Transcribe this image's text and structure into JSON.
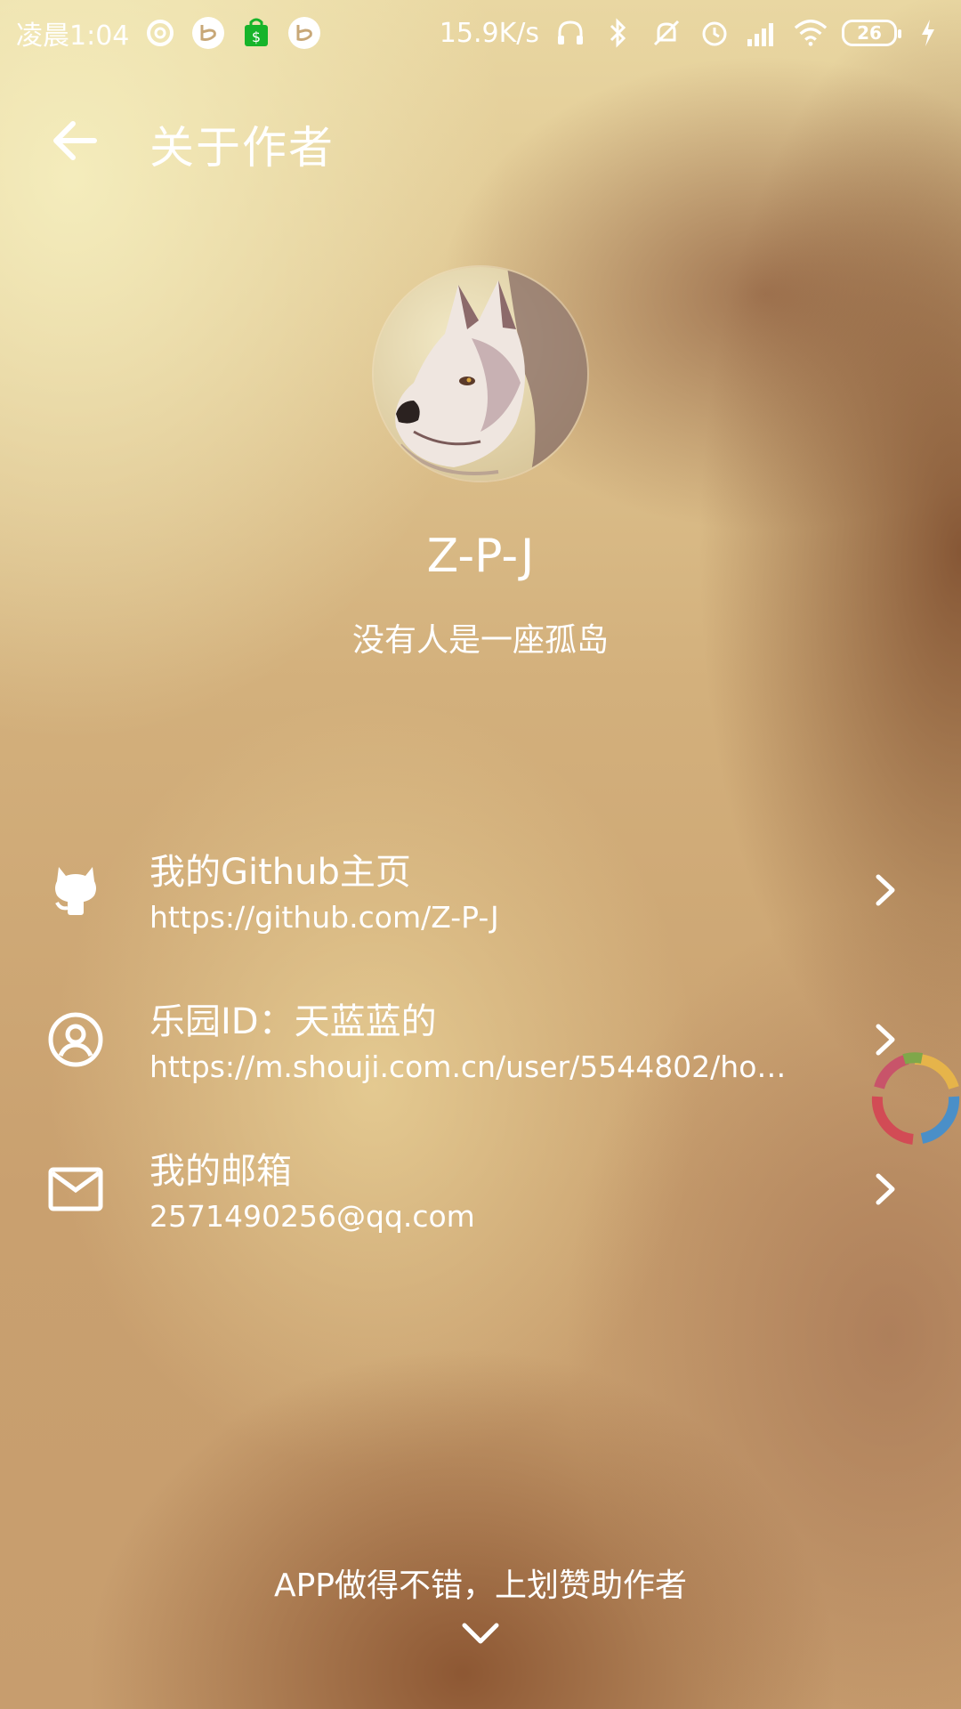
{
  "status_bar": {
    "time": "凌晨1:04",
    "network_speed": "15.9K/s",
    "battery_level": "26",
    "left_icons": [
      "netease-music-icon",
      "bilibili-icon",
      "shopping-bag-icon",
      "bilibili-icon"
    ],
    "right_icons": [
      "headset-icon",
      "bluetooth-icon",
      "mute-icon",
      "alarm-icon",
      "signal-icon",
      "wifi-icon",
      "charging-icon"
    ]
  },
  "toolbar": {
    "title": "关于作者",
    "back_icon": "arrow-left-icon"
  },
  "profile": {
    "name": "Z-P-J",
    "motto": "没有人是一座孤岛"
  },
  "links": [
    {
      "icon": "github-icon",
      "title": "我的Github主页",
      "subtitle": "https://github.com/Z-P-J"
    },
    {
      "icon": "user-circle-icon",
      "title": "乐园ID：天蓝蓝的",
      "subtitle": "https://m.shouji.com.cn/user/5544802/hom..."
    },
    {
      "icon": "mail-icon",
      "title": "我的邮箱",
      "subtitle": "2571490256@qq.com"
    }
  ],
  "footer": {
    "hint": "APP做得不错，上划赞助作者",
    "chevron_icon": "chevron-down-icon"
  },
  "colors": {
    "text": "#ffffff",
    "background_light": "#eedfa8",
    "background_dark": "#8a5533"
  }
}
